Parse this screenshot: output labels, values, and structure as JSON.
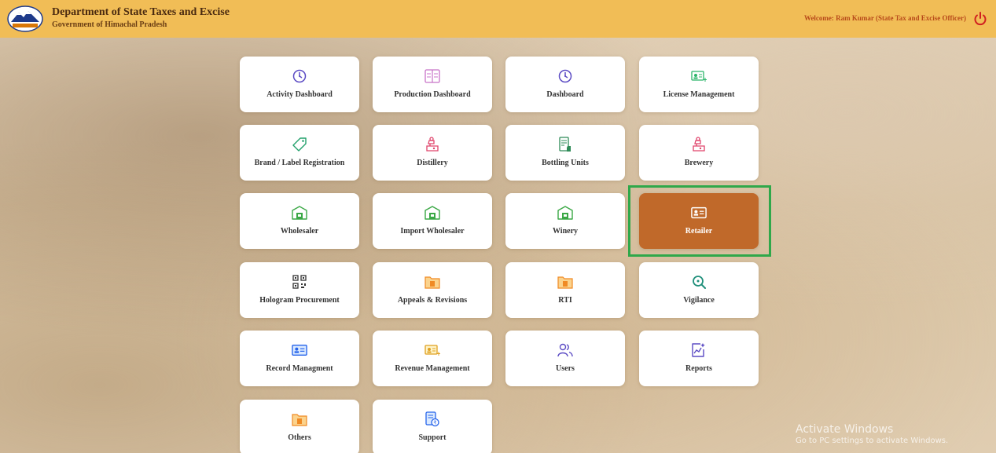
{
  "header": {
    "title": "Department of State Taxes and Excise",
    "subtitle": "Government of Himachal Pradesh",
    "welcome": "Welcome: Ram Kumar (State Tax and Excise Officer)",
    "bg_color": "#f1bd56"
  },
  "tiles": [
    {
      "label": "Activity Dashboard",
      "icon": "clock-icon"
    },
    {
      "label": "Production Dashboard",
      "icon": "grid-list-icon"
    },
    {
      "label": "Dashboard",
      "icon": "clock-icon"
    },
    {
      "label": "License Management",
      "icon": "id-card-icon"
    },
    {
      "label": "Brand / Label Registration",
      "icon": "tag-icon"
    },
    {
      "label": "Distillery",
      "icon": "distillery-icon"
    },
    {
      "label": "Bottling Units",
      "icon": "bottle-icon"
    },
    {
      "label": "Brewery",
      "icon": "distillery-icon"
    },
    {
      "label": "Wholesaler",
      "icon": "warehouse-icon"
    },
    {
      "label": "Import Wholesaler",
      "icon": "warehouse-icon"
    },
    {
      "label": "Winery",
      "icon": "warehouse-icon"
    },
    {
      "label": "Retailer",
      "icon": "id-card-icon",
      "selected": true
    },
    {
      "label": "Hologram Procurement",
      "icon": "qr-code-icon"
    },
    {
      "label": "Appeals & Revisions",
      "icon": "folder-icon"
    },
    {
      "label": "RTI",
      "icon": "folder-icon"
    },
    {
      "label": "Vigilance",
      "icon": "search-zoom-icon"
    },
    {
      "label": "Record Managment",
      "icon": "id-card-icon"
    },
    {
      "label": "Revenue Management",
      "icon": "id-card-icon"
    },
    {
      "label": "Users",
      "icon": "users-icon"
    },
    {
      "label": "Reports",
      "icon": "report-icon"
    },
    {
      "label": "Others",
      "icon": "folder-icon"
    },
    {
      "label": "Support",
      "icon": "support-icon"
    }
  ],
  "watermark": {
    "line1": "Activate Windows",
    "line2": "Go to PC settings to activate Windows."
  },
  "colors": {
    "active_tile": "#c0692a",
    "highlight_border": "#2fa84a"
  }
}
